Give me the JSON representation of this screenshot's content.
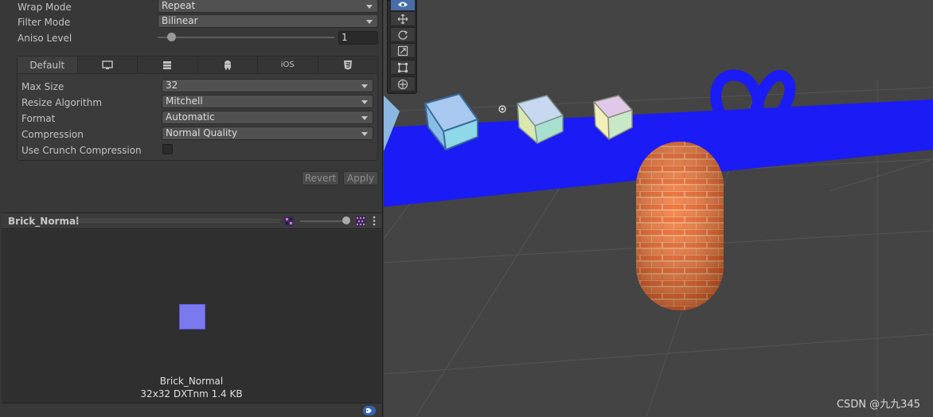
{
  "inspector": {
    "wrap_mode": {
      "label": "Wrap Mode",
      "value": "Repeat"
    },
    "filter_mode": {
      "label": "Filter Mode",
      "value": "Bilinear"
    },
    "aniso_level": {
      "label": "Aniso Level",
      "value": "1",
      "level": 1
    },
    "platform_tabs": [
      {
        "label": "Default",
        "icon": ""
      },
      {
        "label": "",
        "icon": "monitor-icon"
      },
      {
        "label": "",
        "icon": "server-icon"
      },
      {
        "label": "",
        "icon": "android-icon"
      },
      {
        "label": "iOS",
        "icon": ""
      },
      {
        "label": "",
        "icon": "html5-icon"
      }
    ],
    "max_size": {
      "label": "Max Size",
      "value": "32"
    },
    "resize_algorithm": {
      "label": "Resize Algorithm",
      "value": "Mitchell"
    },
    "format": {
      "label": "Format",
      "value": "Automatic"
    },
    "compression": {
      "label": "Compression",
      "value": "Normal Quality"
    },
    "crunch": {
      "label": "Use Crunch Compression",
      "checked": false
    },
    "revert_label": "Revert",
    "apply_label": "Apply"
  },
  "preview": {
    "title": "Brick_Normal",
    "name": "Brick_Normal",
    "info": "32x32  DXTnm  1.4 KB",
    "swatch_color": "#7a79f0"
  },
  "scene": {
    "tools": [
      "eye-icon",
      "move-icon",
      "rotate-icon",
      "scale-icon",
      "rect-icon",
      "transform-icon"
    ],
    "watermark": "CSDN @九九345",
    "colors": {
      "plane": "#1a1aff",
      "capsule": "#f06a2a",
      "torus": "#1a1aff",
      "background": "#444444"
    }
  }
}
